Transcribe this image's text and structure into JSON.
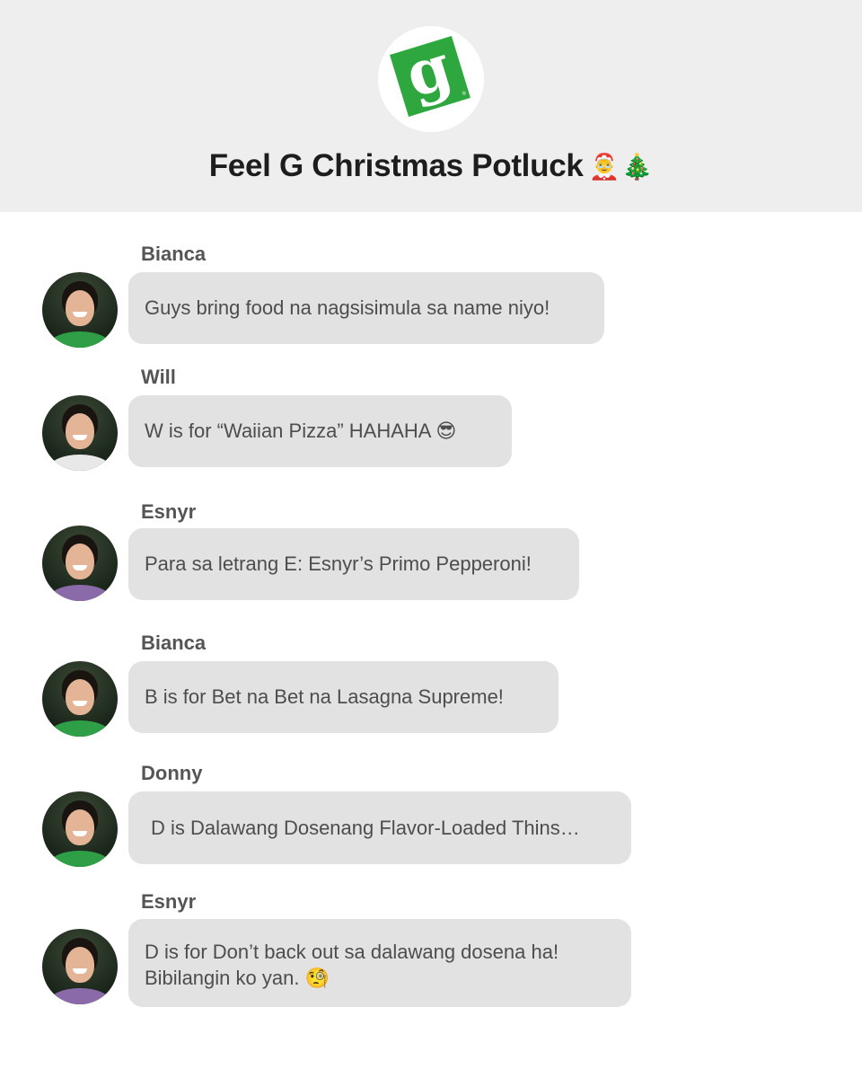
{
  "header": {
    "logo_letter": "g",
    "logo_mark": "®",
    "title": "Feel G Christmas Potluck",
    "title_emojis": [
      "🤶",
      "🎄"
    ]
  },
  "messages": [
    {
      "sender": "Bianca",
      "text": "Guys bring food na nagsisimula sa name niyo!"
    },
    {
      "sender": "Will",
      "text": "W is for “Waiian Pizza” HAHAHA 😎"
    },
    {
      "sender": "Esnyr",
      "text": "Para sa letrang E: Esnyr’s Primo Pepperoni!"
    },
    {
      "sender": "Bianca",
      "text": "B is for Bet na Bet na Lasagna Supreme!"
    },
    {
      "sender": "Donny",
      "text": "D is Dalawang Dosenang Flavor-Loaded Thins…"
    },
    {
      "sender": "Esnyr",
      "lines": [
        "D is for Don’t back out sa dalawang dosena ha!",
        "Bibilangin ko yan. 🧐"
      ]
    }
  ],
  "colors": {
    "header_bg": "#efeeef",
    "bubble_bg": "#e2e2e2",
    "brand_green": "#2ea83e"
  }
}
